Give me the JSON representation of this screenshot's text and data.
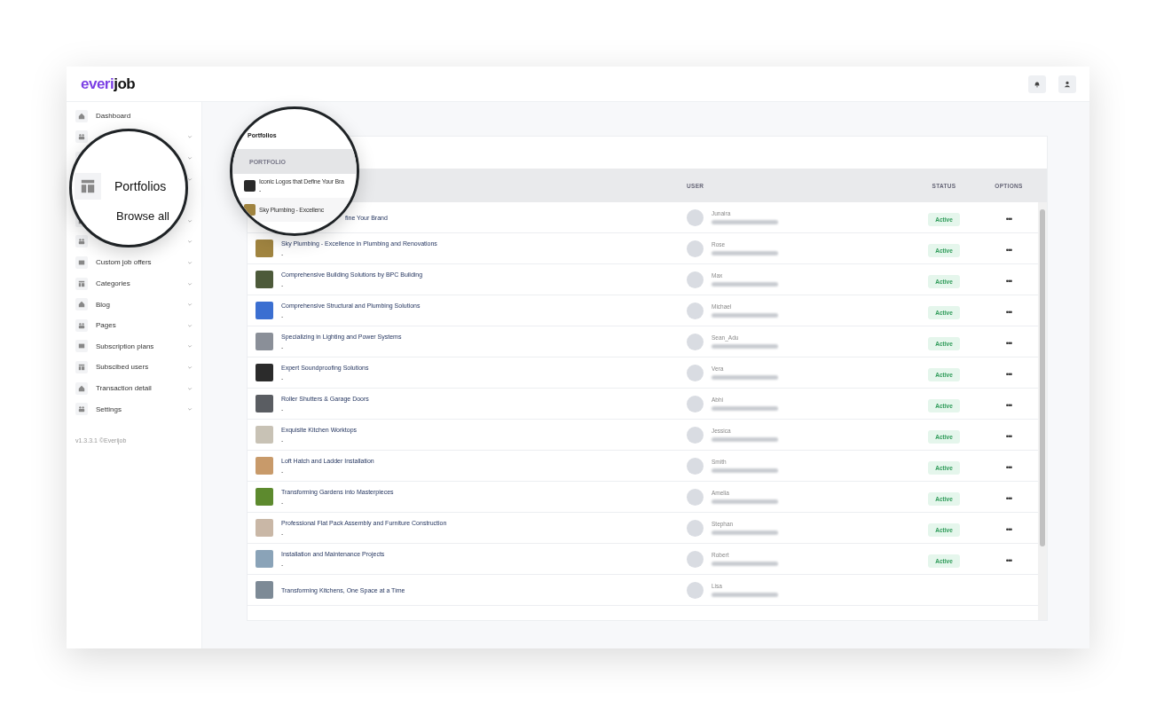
{
  "logo": {
    "part_1": "everi",
    "part_2": "job"
  },
  "sidebar": {
    "items": [
      {
        "label": "Dashboard",
        "expandable": false
      },
      {
        "expandable": true,
        "expanded": false
      },
      {
        "expandable": true,
        "expanded": false
      },
      {
        "expandable": true,
        "expanded": true
      },
      {
        "expandable": true,
        "expanded": false
      },
      {
        "expandable": true,
        "expanded": false
      },
      {
        "label": "Custom job offers",
        "expandable": true
      },
      {
        "label": "Categories",
        "expandable": true
      },
      {
        "label": "Blog",
        "expandable": true
      },
      {
        "label": "Pages",
        "expandable": true
      },
      {
        "label": "Subscription plans",
        "expandable": true
      },
      {
        "label": "Subscibed users",
        "expandable": true
      },
      {
        "label": "Transaction detail",
        "expandable": true
      },
      {
        "label": "Settings",
        "expandable": true
      }
    ],
    "version": "v1.3.3.1 ©Everijob"
  },
  "table": {
    "columns": [
      "USER",
      "STATUS",
      "OPTIONS"
    ],
    "rows": [
      {
        "title": "fine Your Brand",
        "subtitle": null,
        "covered": true,
        "user": "Junaira",
        "status": "Active",
        "options": "•••"
      },
      {
        "title": "Sky Plumbing - Excellence in Plumbing and Renovations",
        "subtitle": "-",
        "covered": false,
        "user": "Rose",
        "status": "Active",
        "options": "•••"
      },
      {
        "title": "Comprehensive Building Solutions by BPC Building",
        "subtitle": "-",
        "covered": false,
        "user": "Max",
        "status": "Active",
        "options": "•••"
      },
      {
        "title": "Comprehensive Structural and Plumbing Solutions",
        "subtitle": "-",
        "covered": false,
        "user": "Michael",
        "status": "Active",
        "options": "•••"
      },
      {
        "title": "Specializing in Lighting and Power Systems",
        "subtitle": "-",
        "covered": false,
        "user": "Sean_Adu",
        "status": "Active",
        "options": "•••"
      },
      {
        "title": "Expert Soundproofing Solutions",
        "subtitle": "-",
        "covered": false,
        "user": "Vera",
        "status": "Active",
        "options": "•••"
      },
      {
        "title": "Roller Shutters & Garage Doors",
        "subtitle": "-",
        "covered": false,
        "user": "Abhi",
        "status": "Active",
        "options": "•••"
      },
      {
        "title": "Exquisite Kitchen Worktops",
        "subtitle": "-",
        "covered": false,
        "user": "Jessica",
        "status": "Active",
        "options": "•••"
      },
      {
        "title": "Loft Hatch and Ladder Installation",
        "subtitle": "-",
        "covered": false,
        "user": "Smith",
        "status": "Active",
        "options": "•••"
      },
      {
        "title": "Transforming Gardens into Masterpieces",
        "subtitle": "-",
        "covered": false,
        "user": "Amelia",
        "status": "Active",
        "options": "•••"
      },
      {
        "title": "Professional Flat Pack Assembly and Furniture Construction",
        "subtitle": "-",
        "covered": false,
        "user": "Stephan",
        "status": "Active",
        "options": "•••"
      },
      {
        "title": "Installation and Maintenance Projects",
        "subtitle": "-",
        "covered": false,
        "user": "Robert",
        "status": "Active",
        "options": "•••"
      },
      {
        "title": "Transforming Kitchens, One Space at a Time",
        "subtitle": null,
        "covered": false,
        "user": "Lisa",
        "status": null,
        "options": null
      }
    ]
  },
  "magnifiers": [
    {
      "kind": "sidebar",
      "label": "Portfolios",
      "sublabel": "Browse all"
    },
    {
      "kind": "table",
      "title": "Portfolios",
      "column": "PORTFOLIO",
      "rows": [
        "Iconic Logos that Define Your Bra",
        "-",
        "Sky Plumbing - Excellenc"
      ]
    }
  ]
}
